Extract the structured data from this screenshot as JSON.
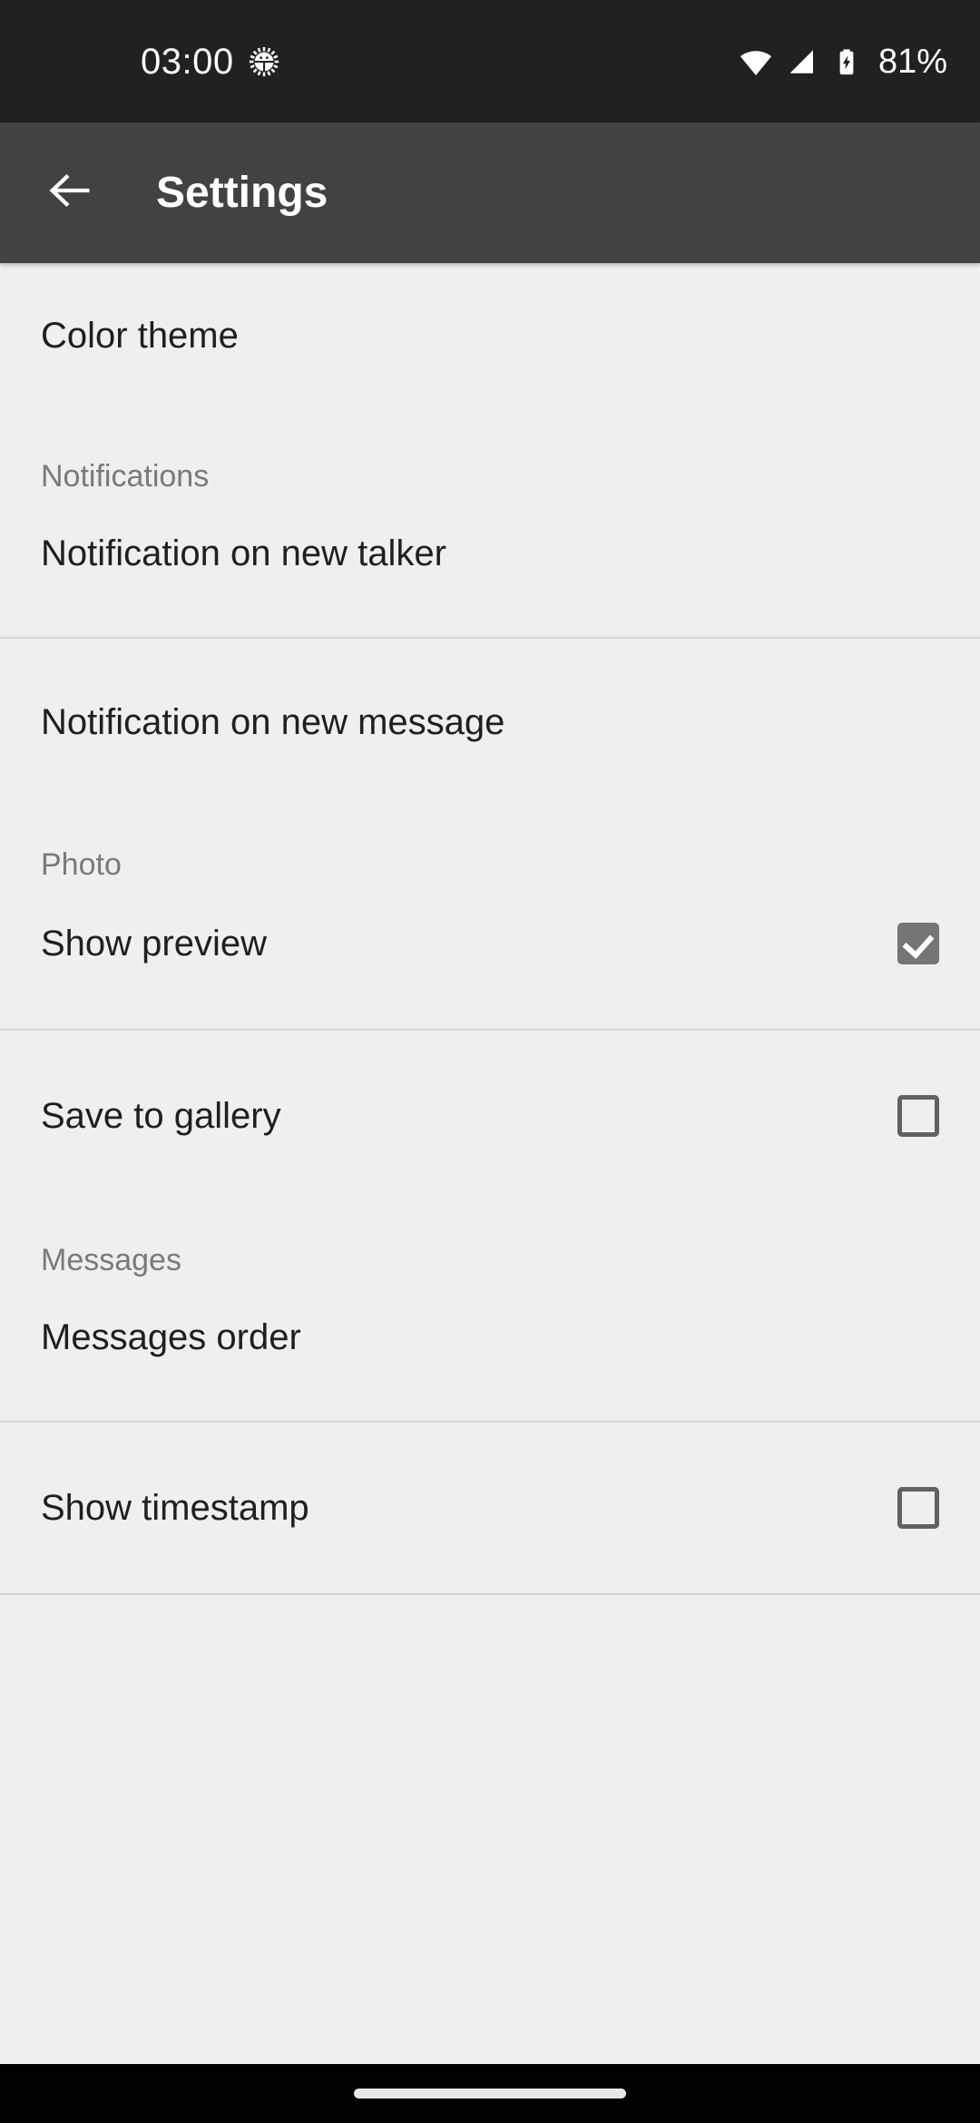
{
  "status_bar": {
    "clock": "03:00",
    "debug_icon": "android-debug-icon",
    "wifi_icon": "wifi-icon",
    "signal_icon": "cellular-signal-icon",
    "battery_icon": "battery-charging-icon",
    "battery_percent": "81%",
    "background_color": "#212121",
    "foreground_color": "#ffffff"
  },
  "app_bar": {
    "back_icon": "arrow-back-icon",
    "title": "Settings",
    "background_color": "#424242",
    "text_color": "#ffffff"
  },
  "settings": {
    "background_color": "#efefef",
    "divider_color": "#d6d6d6",
    "item_text_color": "#1f1f1f",
    "header_text_color": "#7a7a7a",
    "checkbox_checked_color": "#757575",
    "checkbox_unchecked_color": "#616161",
    "items": [
      {
        "label": "Color theme",
        "type": "link"
      }
    ],
    "sections": [
      {
        "header": "Notifications",
        "rows": [
          {
            "label": "Notification on new talker",
            "type": "link"
          },
          {
            "label": "Notification on new message",
            "type": "link"
          }
        ]
      },
      {
        "header": "Photo",
        "rows": [
          {
            "label": "Show preview",
            "type": "checkbox",
            "checked": "true"
          },
          {
            "label": "Save to gallery",
            "type": "checkbox",
            "checked": "false"
          }
        ]
      },
      {
        "header": "Messages",
        "rows": [
          {
            "label": "Messages order",
            "type": "link"
          },
          {
            "label": "Show timestamp",
            "type": "checkbox",
            "checked": "false"
          }
        ]
      }
    ]
  },
  "nav_bar": {
    "gesture_pill": "home-gesture-pill",
    "background_color": "#000000"
  }
}
